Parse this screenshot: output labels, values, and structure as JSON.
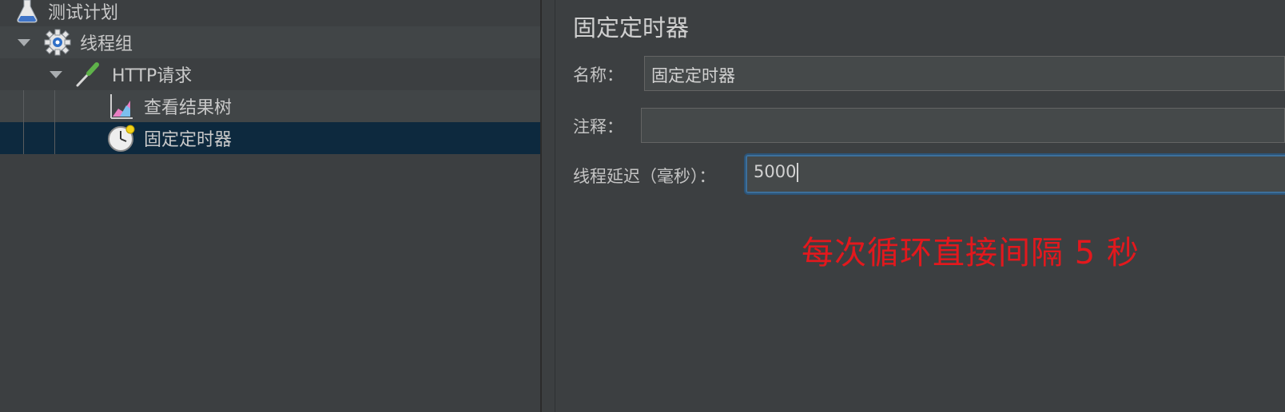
{
  "tree": {
    "items": [
      {
        "label": "测试计划",
        "icon": "flask-icon"
      },
      {
        "label": "线程组",
        "icon": "gear-icon"
      },
      {
        "label": "HTTP请求",
        "icon": "pipette-icon"
      },
      {
        "label": "查看结果树",
        "icon": "chart-icon"
      },
      {
        "label": "固定定时器",
        "icon": "timer-icon"
      }
    ],
    "selected": "固定定时器"
  },
  "panel": {
    "title": "固定定时器",
    "fields": {
      "name": {
        "label": "名称：",
        "value": "固定定时器"
      },
      "comment": {
        "label": "注释：",
        "value": ""
      },
      "delay": {
        "label": "线程延迟（毫秒）：",
        "value": "5000"
      }
    }
  },
  "annotation": "每次循环直接间隔 5 秒",
  "colors": {
    "background": "#3c3f41",
    "selection": "#0d293e",
    "focus_border": "#3d6f9a",
    "annotation": "#e3181d"
  }
}
